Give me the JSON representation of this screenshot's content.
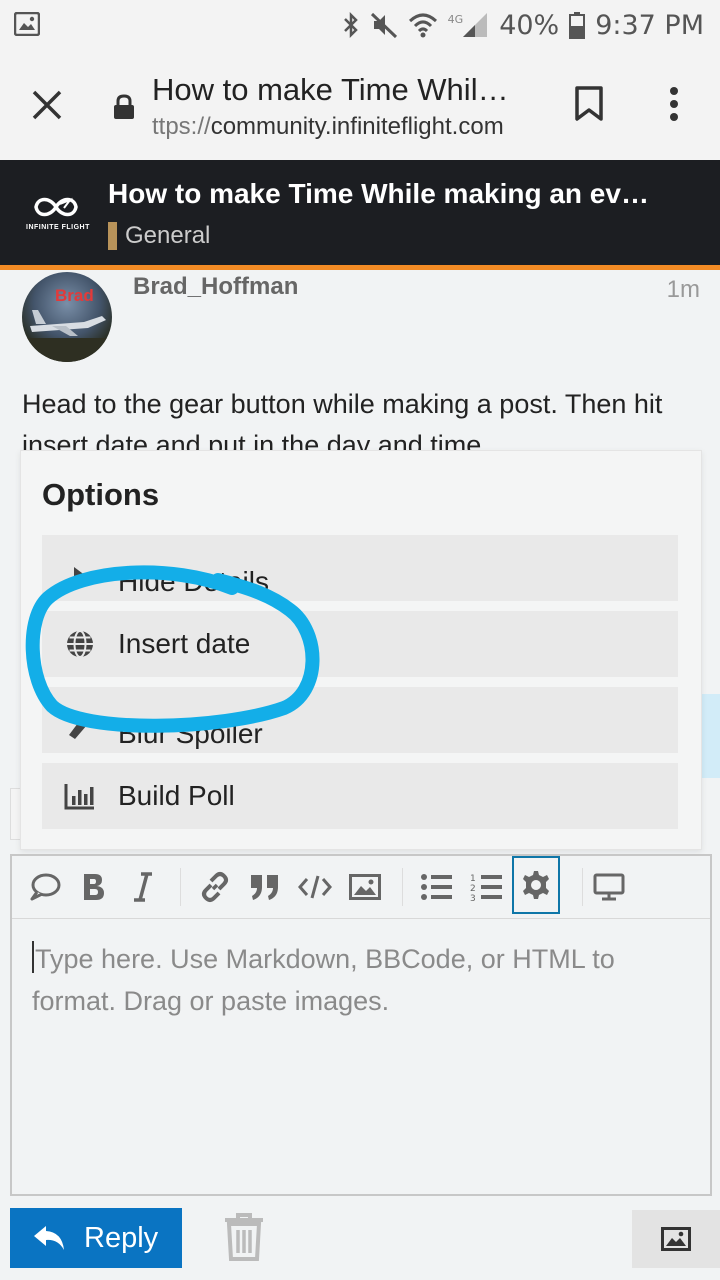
{
  "status_bar": {
    "battery": "40%",
    "time": "9:37 PM",
    "network": "4G"
  },
  "browser": {
    "tab_title": "How to make Time Whil…",
    "url_scheme": "ttps://",
    "url_host": "community.infiniteflight.com"
  },
  "site": {
    "logo_text": "INFINITE FLIGHT",
    "topic_title": "How to make Time While making an ev…",
    "category": "General",
    "category_color": "#b8935a",
    "accent_color": "#f28b25"
  },
  "post": {
    "avatar_text": "Brad",
    "username": "Brad_Hoffman",
    "time": "1m",
    "body": "Head to the gear button while making a post. Then hit insert date and put in the day and time"
  },
  "options_menu": {
    "title": "Options",
    "items": [
      {
        "label": "Hide Details",
        "icon": "caret-right-icon"
      },
      {
        "label": "Insert date",
        "icon": "globe-icon"
      },
      {
        "label": "Blur Spoiler",
        "icon": "spoiler-icon"
      },
      {
        "label": "Build Poll",
        "icon": "bar-chart-icon"
      }
    ],
    "highlight_color": "#13aee8"
  },
  "composer": {
    "placeholder": "Type here. Use Markdown, BBCode, or HTML to format. Drag or paste images.",
    "toolbar": [
      "quote-icon",
      "bold-icon",
      "italic-icon",
      "link-icon",
      "blockquote-icon",
      "code-icon",
      "image-icon",
      "bullet-list-icon",
      "numbered-list-icon",
      "gear-icon",
      "preview-icon"
    ],
    "active_tool": "gear-icon"
  },
  "footer": {
    "reply_label": "Reply",
    "reply_color": "#0a74c2"
  }
}
